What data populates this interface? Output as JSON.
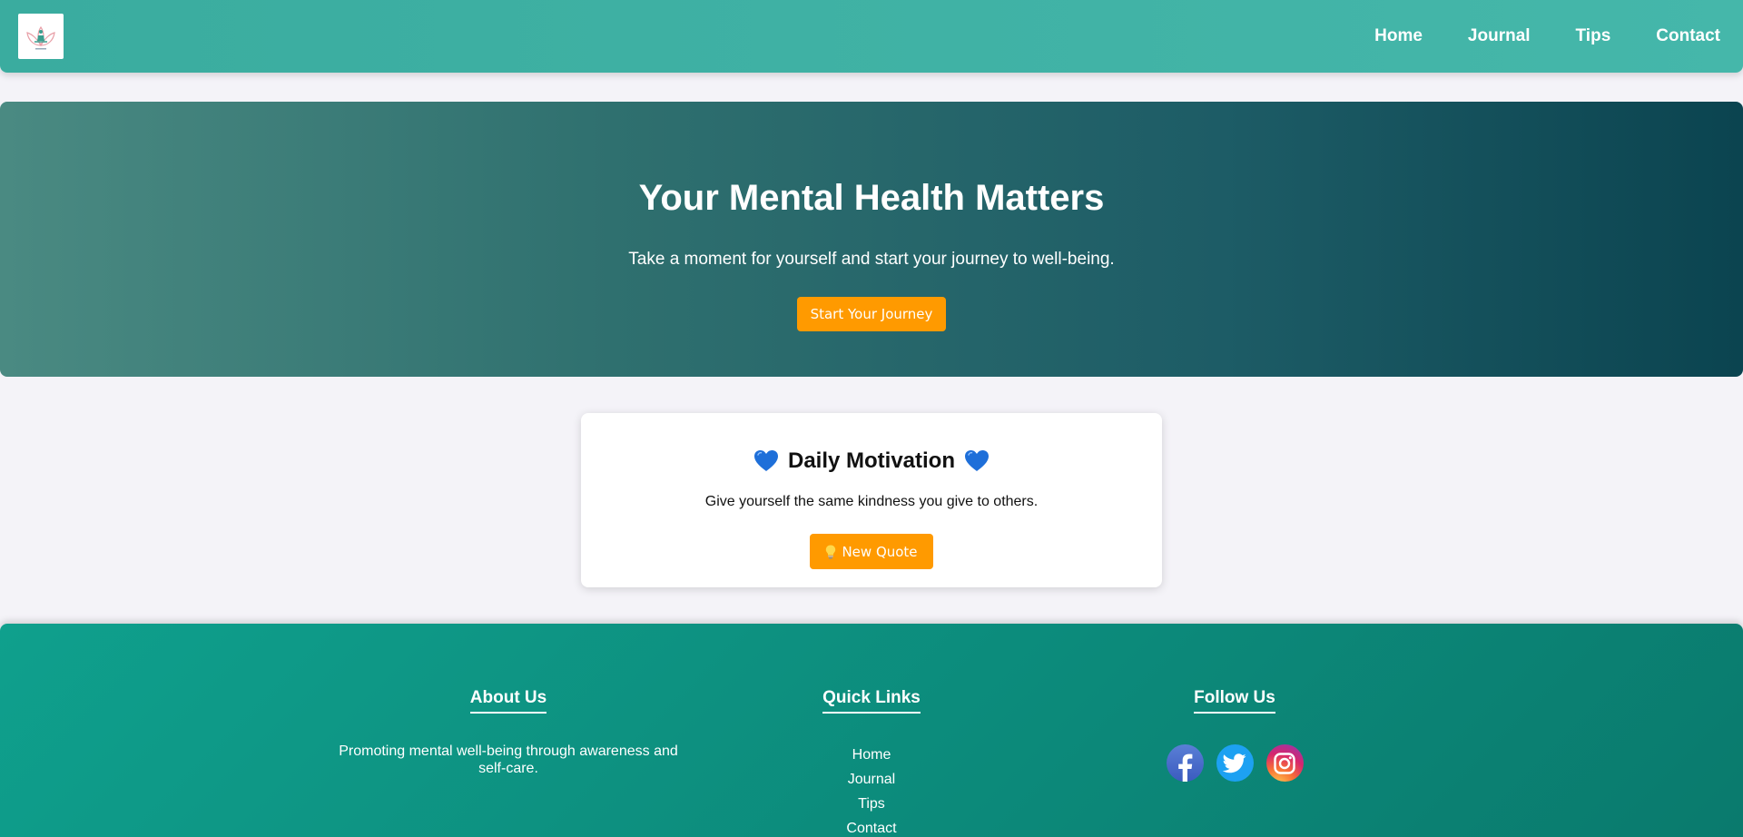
{
  "header": {
    "logo_icon": "meditation-lotus-logo-icon",
    "nav": [
      {
        "label": "Home"
      },
      {
        "label": "Journal"
      },
      {
        "label": "Tips"
      },
      {
        "label": "Contact"
      }
    ]
  },
  "hero": {
    "title": "Your Mental Health Matters",
    "subtitle": "Take a moment for yourself and start your journey to well-being.",
    "button_label": "Start Your Journey"
  },
  "motivation": {
    "title": "Daily Motivation",
    "heart_icon": "blue-heart-icon",
    "quote": "Give yourself the same kindness you give to others.",
    "button_label": "New Quote",
    "button_icon": "lightbulb-icon"
  },
  "footer": {
    "about": {
      "heading": "About Us",
      "text": "Promoting mental well-being through awareness and self-care."
    },
    "quick_links": {
      "heading": "Quick Links",
      "items": [
        "Home",
        "Journal",
        "Tips",
        "Contact"
      ]
    },
    "follow": {
      "heading": "Follow Us",
      "icons": [
        "facebook-icon",
        "twitter-icon",
        "instagram-icon"
      ]
    }
  },
  "colors": {
    "header_teal": "#3aac9f",
    "hero_dark_teal": "#0b4450",
    "accent_orange": "#ff9a00",
    "footer_teal": "#0fa08d",
    "page_background": "#f4f3f8",
    "heart_blue": "#1e6fd9"
  }
}
